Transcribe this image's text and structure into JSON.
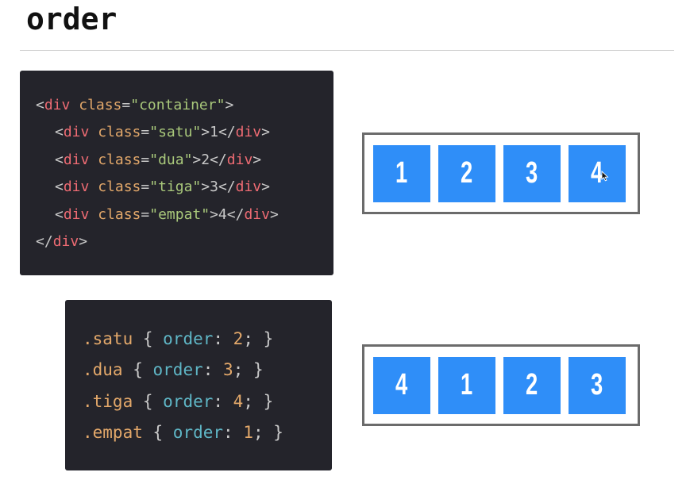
{
  "page": {
    "title": "order"
  },
  "html_code": {
    "lines": [
      [
        {
          "t": "<",
          "c": "p"
        },
        {
          "t": "div",
          "c": "tg"
        },
        {
          "t": " ",
          "c": "p"
        },
        {
          "t": "class",
          "c": "at"
        },
        {
          "t": "=",
          "c": "p"
        },
        {
          "t": "\"container\"",
          "c": "st"
        },
        {
          "t": ">",
          "c": "p"
        }
      ],
      [
        {
          "t": "<",
          "c": "p"
        },
        {
          "t": "div",
          "c": "tg"
        },
        {
          "t": " ",
          "c": "p"
        },
        {
          "t": "class",
          "c": "at"
        },
        {
          "t": "=",
          "c": "p"
        },
        {
          "t": "\"satu\"",
          "c": "st"
        },
        {
          "t": ">1</",
          "c": "p"
        },
        {
          "t": "div",
          "c": "tg"
        },
        {
          "t": ">",
          "c": "p"
        }
      ],
      [
        {
          "t": "<",
          "c": "p"
        },
        {
          "t": "div",
          "c": "tg"
        },
        {
          "t": " ",
          "c": "p"
        },
        {
          "t": "class",
          "c": "at"
        },
        {
          "t": "=",
          "c": "p"
        },
        {
          "t": "\"dua\"",
          "c": "st"
        },
        {
          "t": ">2</",
          "c": "p"
        },
        {
          "t": "div",
          "c": "tg"
        },
        {
          "t": ">",
          "c": "p"
        }
      ],
      [
        {
          "t": "<",
          "c": "p"
        },
        {
          "t": "div",
          "c": "tg"
        },
        {
          "t": " ",
          "c": "p"
        },
        {
          "t": "class",
          "c": "at"
        },
        {
          "t": "=",
          "c": "p"
        },
        {
          "t": "\"tiga\"",
          "c": "st"
        },
        {
          "t": ">3</",
          "c": "p"
        },
        {
          "t": "div",
          "c": "tg"
        },
        {
          "t": ">",
          "c": "p"
        }
      ],
      [
        {
          "t": "<",
          "c": "p"
        },
        {
          "t": "div",
          "c": "tg"
        },
        {
          "t": " ",
          "c": "p"
        },
        {
          "t": "class",
          "c": "at"
        },
        {
          "t": "=",
          "c": "p"
        },
        {
          "t": "\"empat\"",
          "c": "st"
        },
        {
          "t": ">4</",
          "c": "p"
        },
        {
          "t": "div",
          "c": "tg"
        },
        {
          "t": ">",
          "c": "p"
        }
      ],
      [
        {
          "t": "</",
          "c": "p"
        },
        {
          "t": "div",
          "c": "tg"
        },
        {
          "t": ">",
          "c": "p"
        }
      ]
    ],
    "indented": [
      false,
      true,
      true,
      true,
      true,
      false
    ]
  },
  "css_code": {
    "lines": [
      [
        {
          "t": ".satu",
          "c": "sl"
        },
        {
          "t": " { ",
          "c": "p"
        },
        {
          "t": "order",
          "c": "pr"
        },
        {
          "t": ": ",
          "c": "p"
        },
        {
          "t": "2",
          "c": "nu"
        },
        {
          "t": "; }",
          "c": "p"
        }
      ],
      [
        {
          "t": ".dua",
          "c": "sl"
        },
        {
          "t": " { ",
          "c": "p"
        },
        {
          "t": "order",
          "c": "pr"
        },
        {
          "t": ": ",
          "c": "p"
        },
        {
          "t": "3",
          "c": "nu"
        },
        {
          "t": "; }",
          "c": "p"
        }
      ],
      [
        {
          "t": ".tiga",
          "c": "sl"
        },
        {
          "t": " { ",
          "c": "p"
        },
        {
          "t": "order",
          "c": "pr"
        },
        {
          "t": ": ",
          "c": "p"
        },
        {
          "t": "4",
          "c": "nu"
        },
        {
          "t": "; }",
          "c": "p"
        }
      ],
      [
        {
          "t": ".empat",
          "c": "sl"
        },
        {
          "t": " { ",
          "c": "p"
        },
        {
          "t": "order",
          "c": "pr"
        },
        {
          "t": ": ",
          "c": "p"
        },
        {
          "t": "1",
          "c": "nu"
        },
        {
          "t": "; }",
          "c": "p"
        }
      ]
    ]
  },
  "demo_before": {
    "items": [
      "1",
      "2",
      "3",
      "4"
    ]
  },
  "demo_after": {
    "items": [
      "4",
      "1",
      "2",
      "3"
    ]
  },
  "colors": {
    "box_blue": "#2f8ef8",
    "code_bg": "#24242b",
    "tag": "#ee6b73",
    "attribute": "#e3a86a",
    "string": "#a9c87b",
    "property": "#5fb6c6",
    "number": "#e3a86a",
    "punctuation": "#c9c9c9",
    "demo_border": "#6b6b6b"
  },
  "icons": {
    "cursor": "mouse-pointer-icon"
  }
}
